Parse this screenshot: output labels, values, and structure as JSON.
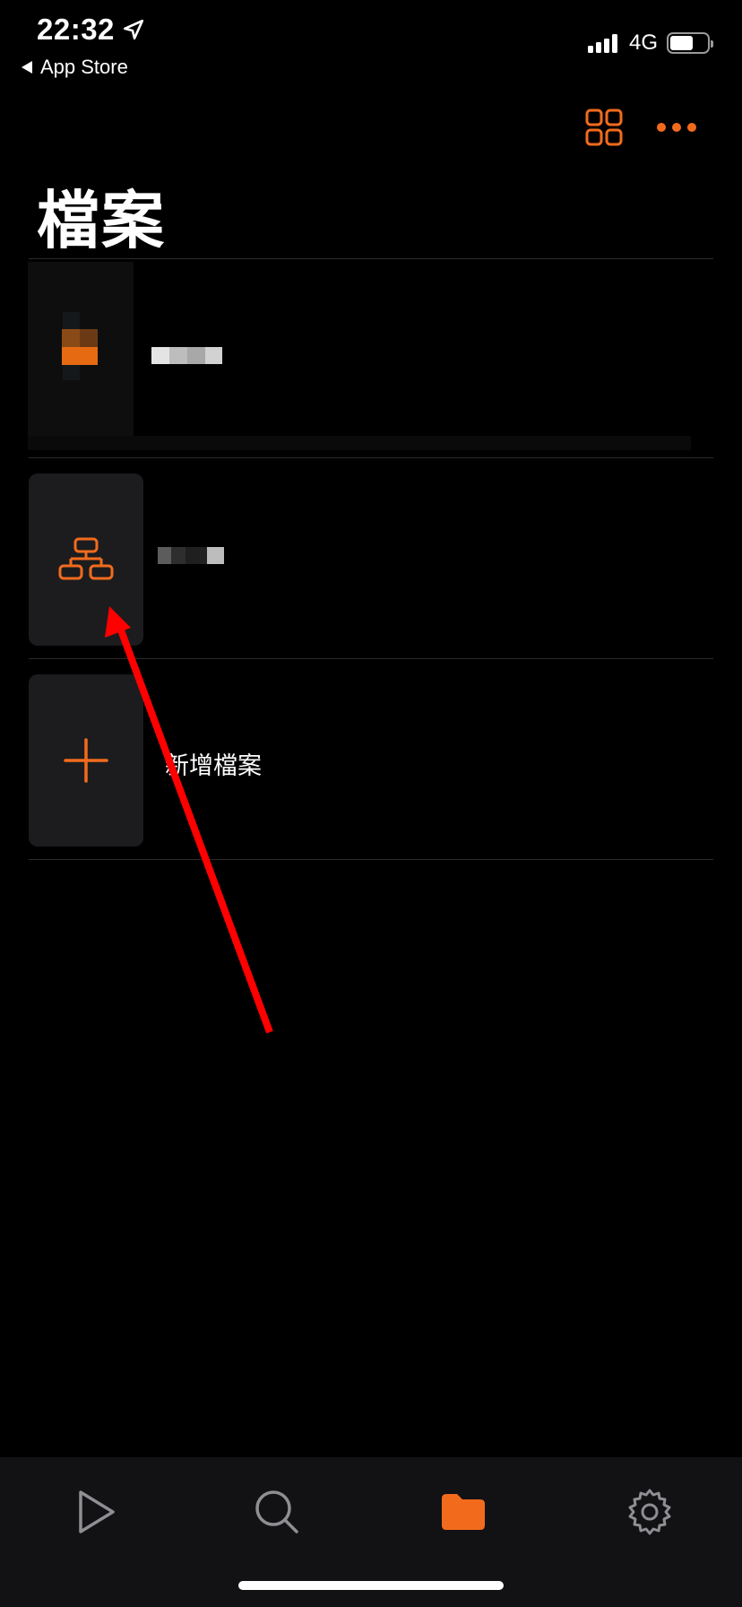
{
  "status_bar": {
    "time": "22:32",
    "back_app": "App Store",
    "network": "4G",
    "battery_level": 0.62
  },
  "header": {
    "title": "檔案",
    "grid_icon": "grid-icon",
    "more_icon": "more-icon"
  },
  "files": [
    {
      "name": "",
      "thumbnail": "document-thumbnail"
    },
    {
      "name": "",
      "icon": "flowchart-icon"
    }
  ],
  "new_file": {
    "label": "新增檔案",
    "icon": "plus-icon"
  },
  "annotation": {
    "type": "red-arrow",
    "color": "#ff0000"
  },
  "tab_bar": {
    "items": [
      {
        "icon": "play-icon",
        "active": false
      },
      {
        "icon": "search-icon",
        "active": false
      },
      {
        "icon": "folder-icon",
        "active": true
      },
      {
        "icon": "gear-icon",
        "active": false
      }
    ]
  },
  "colors": {
    "accent": "#f26b1d",
    "background": "#000000",
    "card": "#1c1c1e",
    "tab_bar": "#121214",
    "inactive_icon": "#8e8e93"
  }
}
